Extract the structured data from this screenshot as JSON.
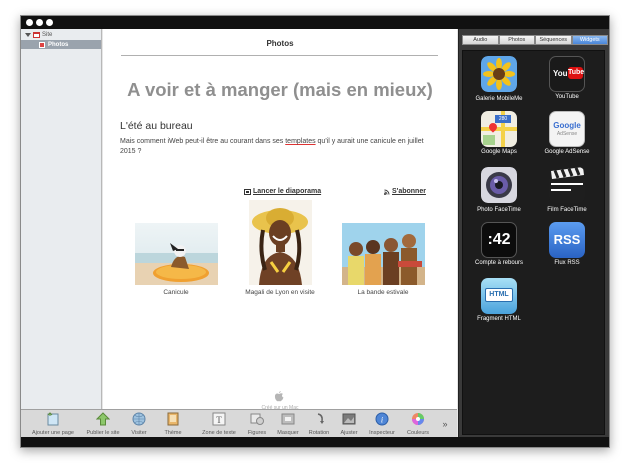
{
  "sidebar": {
    "site_label": "Site",
    "page_label": "Photos"
  },
  "page": {
    "title": "Photos",
    "heading": "A voir et à manger (mais en mieux)",
    "subheading": "L'été au bureau",
    "paragraph_before": "Mais comment iWeb peut-il être au courant dans ses ",
    "paragraph_link": "templates",
    "paragraph_after": " qu'il y aurait une canicule en juillet 2015 ?",
    "slideshow_link": "Lancer le diaporama",
    "subscribe_link": "S'abonner",
    "photos": [
      {
        "caption": "Canicule"
      },
      {
        "caption": "Magali de Lyon en visite"
      },
      {
        "caption": "La bande estivale"
      }
    ],
    "footer": "Créé sur un Mac"
  },
  "toolbar": {
    "items": [
      {
        "label": "Ajouter une page"
      },
      {
        "label": "Publier le site"
      },
      {
        "label": "Visiter"
      },
      {
        "label": "Thème"
      },
      {
        "label": "Zone de texte"
      },
      {
        "label": "Figures"
      },
      {
        "label": "Masquer"
      },
      {
        "label": "Rotation"
      },
      {
        "label": "Ajuster"
      },
      {
        "label": "Inspecteur"
      },
      {
        "label": "Couleurs"
      }
    ],
    "overflow": "»"
  },
  "media": {
    "tabs": [
      {
        "label": "Audio"
      },
      {
        "label": "Photos"
      },
      {
        "label": "Séquences"
      },
      {
        "label": "Widgets"
      }
    ],
    "active_tab": "Widgets",
    "widgets": [
      {
        "label": "Galerie MobileMe",
        "icon": "sunflower-icon"
      },
      {
        "label": "YouTube",
        "icon": "youtube-icon",
        "icon_text": "You Tube"
      },
      {
        "label": "Google Maps",
        "icon": "google-maps-icon",
        "icon_text": "280"
      },
      {
        "label": "Google AdSense",
        "icon": "google-adsense-icon",
        "icon_text": "Google",
        "icon_text2": "AdSense"
      },
      {
        "label": "Photo FaceTime",
        "icon": "camera-lens-icon"
      },
      {
        "label": "Film FaceTime",
        "icon": "clapperboard-icon"
      },
      {
        "label": "Compte à rebours",
        "icon": "countdown-icon",
        "icon_text": ":42"
      },
      {
        "label": "Flux RSS",
        "icon": "rss-icon",
        "icon_text": "RSS"
      },
      {
        "label": "Fragment HTML",
        "icon": "html-snippet-icon",
        "icon_text": "HTML"
      }
    ]
  },
  "colors": {
    "active_tab": "#4a86d9",
    "heading": "#8f8f8f",
    "widget_panel": "#1d1d1d"
  }
}
